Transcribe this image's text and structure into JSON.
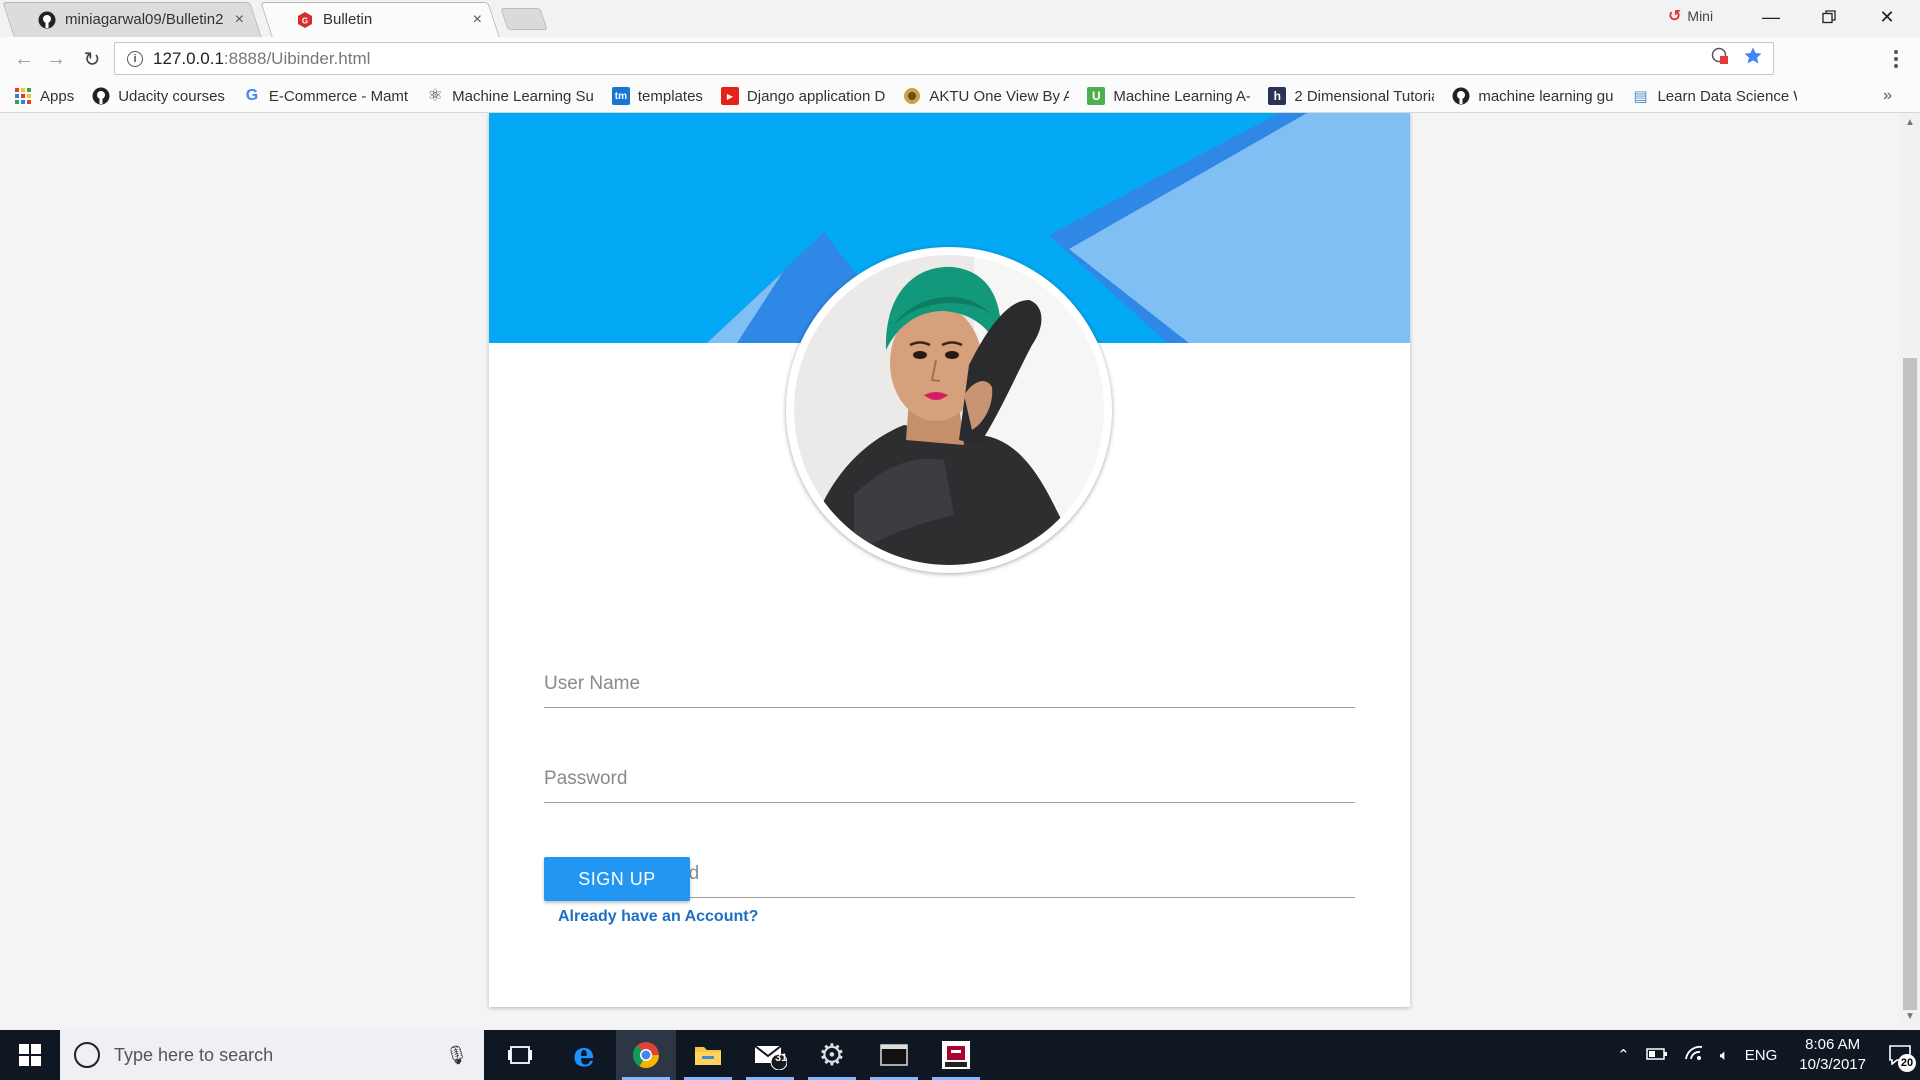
{
  "browser": {
    "tabs": [
      {
        "title": "miniagarwal09/Bulletin2",
        "icon": "github-icon",
        "active": false
      },
      {
        "title": "Bulletin",
        "icon": "gwt-icon",
        "active": true
      }
    ],
    "profile_name": "Mini",
    "url_host": "127.0.0.1",
    "url_path": ":8888/Uibinder.html",
    "bookmarks": [
      {
        "label": "Apps",
        "icon": "apps-grid-icon"
      },
      {
        "label": "Udacity courses",
        "icon": "github-icon"
      },
      {
        "label": "E-Commerce - Mamt",
        "icon": "google-icon"
      },
      {
        "label": "Machine Learning Su",
        "icon": "atom-icon"
      },
      {
        "label": "templates",
        "icon": "tm-icon"
      },
      {
        "label": "Django application D",
        "icon": "youtube-icon"
      },
      {
        "label": "AKTU One View By A",
        "icon": "aktu-icon"
      },
      {
        "label": "Machine Learning A-",
        "icon": "udemy-icon"
      },
      {
        "label": "2 Dimensional Tutoria",
        "icon": "hackerearth-icon"
      },
      {
        "label": "machine learning gu",
        "icon": "github-icon"
      },
      {
        "label": "Learn Data Science W",
        "icon": "book-icon"
      }
    ],
    "bookmarks_overflow": "»"
  },
  "form": {
    "username_placeholder": "User Name",
    "password_placeholder": "Password",
    "confirm_placeholder": "Confirm Password",
    "signup_label": "SIGN UP",
    "login_link": "Already have an Account?"
  },
  "colors": {
    "banner_blue": "#03a9f4",
    "banner_dark": "#2f88e6",
    "banner_light": "#7fbff4",
    "button_blue": "#2196f3",
    "link_blue": "#1e6fc3"
  },
  "taskbar": {
    "search_placeholder": "Type here to search",
    "mail_count": "31",
    "language": "ENG",
    "time": "8:06 AM",
    "date": "10/3/2017",
    "notification_count": "20",
    "apps": [
      "task-view-icon",
      "edge-icon",
      "chrome-icon",
      "file-explorer-icon",
      "mail-icon",
      "settings-gear-icon",
      "terminal-icon",
      "erlang-icon"
    ]
  }
}
